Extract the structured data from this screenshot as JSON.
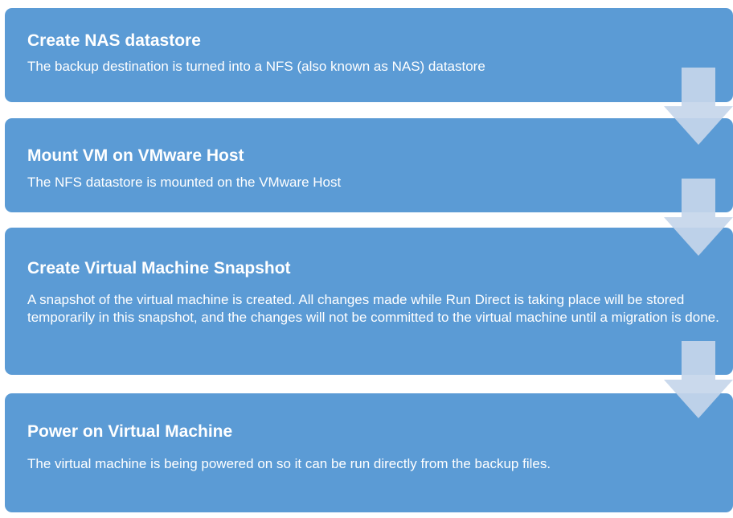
{
  "steps": [
    {
      "title": "Create NAS datastore",
      "description": "The backup destination is turned into a NFS (also known as NAS) datastore"
    },
    {
      "title": "Mount VM on VMware Host",
      "description": "The NFS datastore is mounted on the VMware Host"
    },
    {
      "title": "Create Virtual Machine Snapshot",
      "description": "A snapshot of the virtual machine is created. All changes made while Run Direct is taking place will be stored temporarily in this snapshot, and the changes will not be committed to the virtual machine until a migration is done."
    },
    {
      "title": "Power on Virtual Machine",
      "description": "The virtual machine is being powered on so it can be run directly from the backup files."
    }
  ],
  "colors": {
    "box_fill": "#5b9bd5",
    "arrow_fill": "#c5d6ea",
    "text": "#ffffff"
  }
}
